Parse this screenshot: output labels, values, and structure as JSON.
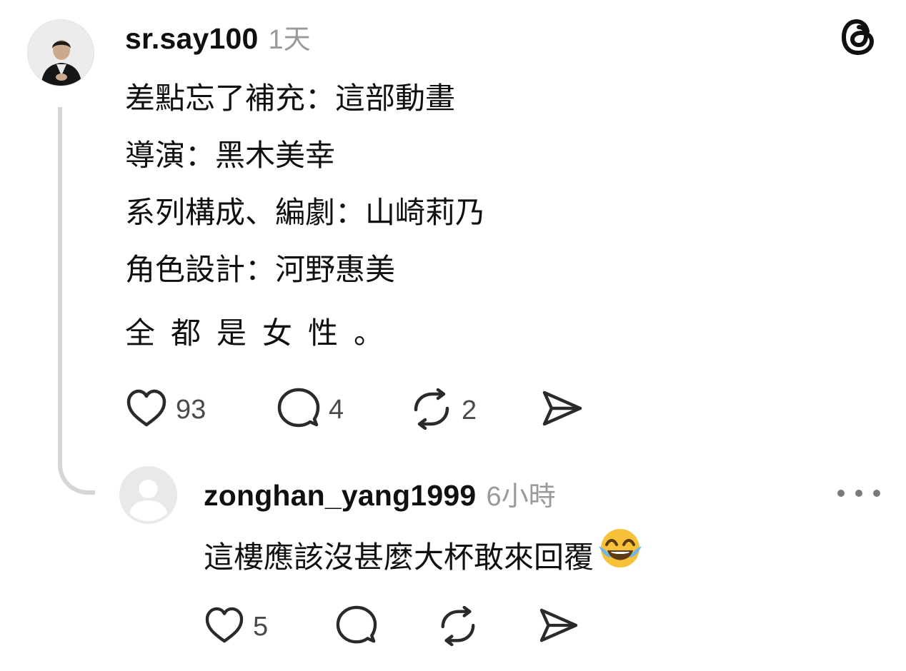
{
  "post": {
    "username": "sr.say100",
    "timestamp": "1天",
    "lines": [
      "差點忘了補充：這部動畫",
      "導演：黑木美幸",
      "系列構成、編劇：山崎莉乃",
      "角色設計：河野惠美"
    ],
    "closing_line": "全都是女性。",
    "stats": {
      "likes": "93",
      "replies": "4",
      "reposts": "2"
    }
  },
  "reply": {
    "username": "zonghan_yang1999",
    "timestamp": "6小時",
    "text": "這樓應該沒甚麼大杯敢來回覆",
    "emoji": "face-with-tears-of-joy",
    "stats": {
      "likes": "5"
    }
  },
  "icons": {
    "brand": "threads-logo-icon",
    "more": "more-dots-icon",
    "like": "heart-icon",
    "comment": "comment-bubble-icon",
    "repost": "repost-icon",
    "share": "send-icon"
  },
  "colors": {
    "text": "#101010",
    "muted": "#9a9a9a",
    "icon": "#2a2a2a",
    "thread_line": "#d6d6d6"
  }
}
